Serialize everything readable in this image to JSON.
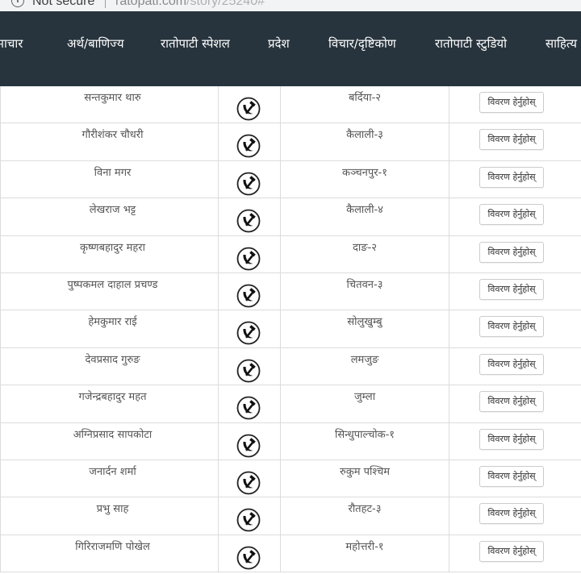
{
  "browser": {
    "security_label": "Not secure",
    "url_host": "ratopati.com",
    "url_path": "/story/25240#"
  },
  "nav": {
    "items": [
      "माचार",
      "अर्थ/बाणिज्य",
      "रातोपाटी स्पेशल",
      "प्रदेश",
      "विचार/दृष्टिकोण",
      "रातोपाटी स्टुडियो",
      "साहित्य"
    ]
  },
  "table": {
    "button_label": "विवरण हेर्नुहोस्",
    "rows": [
      {
        "name": "सन्तकुमार थारु",
        "constituency": "बर्दिया-२"
      },
      {
        "name": "गौरीशंकर चौधरी",
        "constituency": "कैलाली-३"
      },
      {
        "name": "विना मगर",
        "constituency": "कञ्चनपुर-१"
      },
      {
        "name": "लेखराज भट्ट",
        "constituency": "कैलाली-४"
      },
      {
        "name": "कृष्णबहादुर महरा",
        "constituency": "दाङ-२"
      },
      {
        "name": "पुष्पकमल दाहाल प्रचण्ड",
        "constituency": "चितवन-३"
      },
      {
        "name": "हेमकुमार राई",
        "constituency": "सोलुखुम्बु"
      },
      {
        "name": "देवप्रसाद गुरुङ",
        "constituency": "लमजुङ"
      },
      {
        "name": "गजेन्द्रबहादुर महत",
        "constituency": "जुम्ला"
      },
      {
        "name": "अग्निप्रसाद सापकोटा",
        "constituency": "सिन्धुपाल्चोक-१"
      },
      {
        "name": "जनार्दन शर्मा",
        "constituency": "रुकुम पश्चिम"
      },
      {
        "name": "प्रभु साह",
        "constituency": "रौतहट-३"
      },
      {
        "name": "गिरिराजमणि पोखेल",
        "constituency": "महोत्तरी-१"
      }
    ]
  }
}
